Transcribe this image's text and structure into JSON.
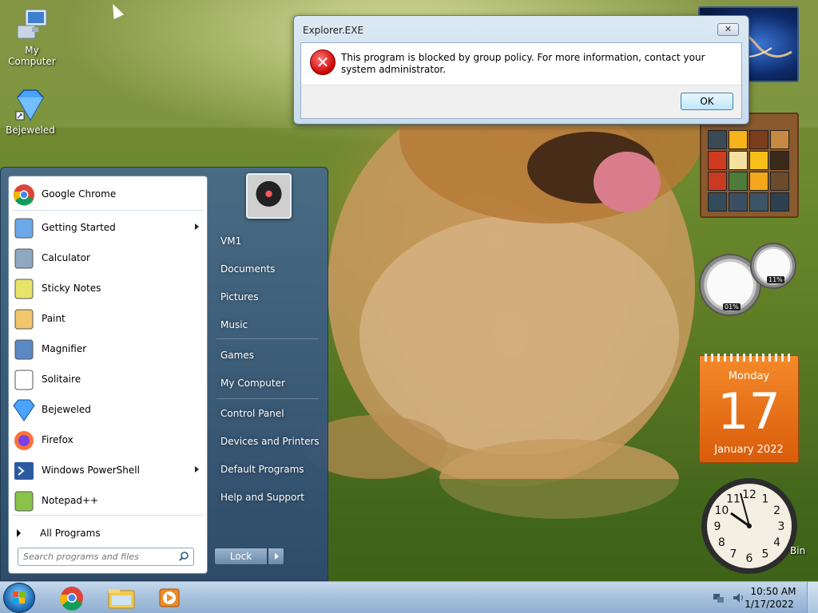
{
  "desktop": {
    "icons": [
      {
        "label": "My Computer",
        "icon": "computer-icon"
      },
      {
        "label": "Bejeweled",
        "icon": "diamond-icon"
      }
    ],
    "recycle_bin_label": "Bin"
  },
  "dialog": {
    "title": "Explorer.EXE",
    "close_label": "✕",
    "message": "This program is blocked by group policy. For more information, contact your system administrator.",
    "ok_label": "OK",
    "icon": "error-icon"
  },
  "start_menu": {
    "programs": [
      {
        "label": "Google Chrome",
        "icon": "chrome-icon",
        "submenu": false
      },
      {
        "label": "Getting Started",
        "icon": "getting-started-icon",
        "submenu": true
      },
      {
        "label": "Calculator",
        "icon": "calculator-icon",
        "submenu": false
      },
      {
        "label": "Sticky Notes",
        "icon": "sticky-notes-icon",
        "submenu": false
      },
      {
        "label": "Paint",
        "icon": "paint-icon",
        "submenu": false
      },
      {
        "label": "Magnifier",
        "icon": "magnifier-icon",
        "submenu": false
      },
      {
        "label": "Solitaire",
        "icon": "solitaire-icon",
        "submenu": false
      },
      {
        "label": "Bejeweled",
        "icon": "diamond-icon",
        "submenu": false
      },
      {
        "label": "Firefox",
        "icon": "firefox-icon",
        "submenu": false
      },
      {
        "label": "Windows PowerShell",
        "icon": "powershell-icon",
        "submenu": true
      },
      {
        "label": "Notepad++",
        "icon": "notepadpp-icon",
        "submenu": false
      }
    ],
    "all_programs_label": "All Programs",
    "search_placeholder": "Search programs and files",
    "right_links": [
      "VM1",
      "Documents",
      "Pictures",
      "Music",
      "Games",
      "My Computer",
      "Control Panel",
      "Devices and Printers",
      "Default Programs",
      "Help and Support"
    ],
    "lock_label": "Lock"
  },
  "gadgets": {
    "cpu_percent": "01%",
    "memory_percent": "11%",
    "calendar": {
      "weekday": "Monday",
      "day": "17",
      "month_year": "January 2022"
    },
    "clock_numbers": [
      "12",
      "1",
      "2",
      "3",
      "4",
      "5",
      "6",
      "7",
      "8",
      "9",
      "10",
      "11"
    ]
  },
  "taskbar": {
    "pinned": [
      "chrome-icon",
      "explorer-icon",
      "media-player-icon"
    ],
    "time": "10:50 AM",
    "date": "1/17/2022"
  }
}
